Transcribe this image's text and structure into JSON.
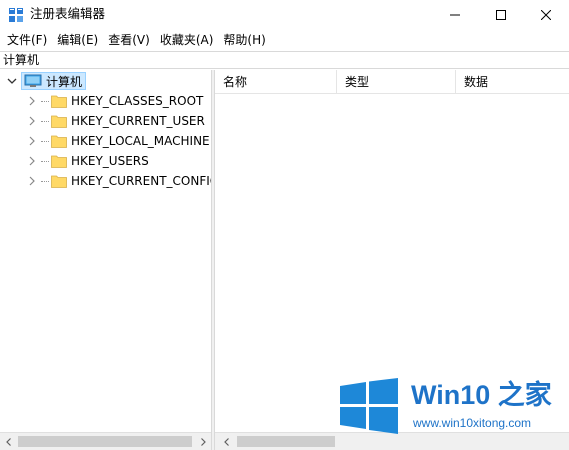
{
  "window": {
    "title": "注册表编辑器",
    "controls": {
      "minimize": "minimize-icon",
      "maximize": "maximize-icon",
      "close": "close-icon"
    }
  },
  "menu": {
    "items": [
      {
        "label": "文件(F)"
      },
      {
        "label": "编辑(E)"
      },
      {
        "label": "查看(V)"
      },
      {
        "label": "收藏夹(A)"
      },
      {
        "label": "帮助(H)"
      }
    ]
  },
  "address": {
    "path": "计算机"
  },
  "tree": {
    "root": {
      "label": "计算机",
      "icon": "computer-icon",
      "expanded": true,
      "selected": true
    },
    "children": [
      {
        "label": "HKEY_CLASSES_ROOT",
        "icon": "folder-icon"
      },
      {
        "label": "HKEY_CURRENT_USER",
        "icon": "folder-icon"
      },
      {
        "label": "HKEY_LOCAL_MACHINE",
        "icon": "folder-icon"
      },
      {
        "label": "HKEY_USERS",
        "icon": "folder-icon"
      },
      {
        "label": "HKEY_CURRENT_CONFIG",
        "icon": "folder-icon"
      }
    ]
  },
  "list": {
    "columns": [
      {
        "label": "名称"
      },
      {
        "label": "类型"
      },
      {
        "label": "数据"
      }
    ]
  },
  "watermark": {
    "brand": "Win10 之家",
    "url": "www.win10xitong.com"
  },
  "colors": {
    "selection_bg": "#cce8ff",
    "selection_border": "#99d1ff",
    "folder": "#ffd966",
    "watermark_blue": "#1e73c8"
  }
}
